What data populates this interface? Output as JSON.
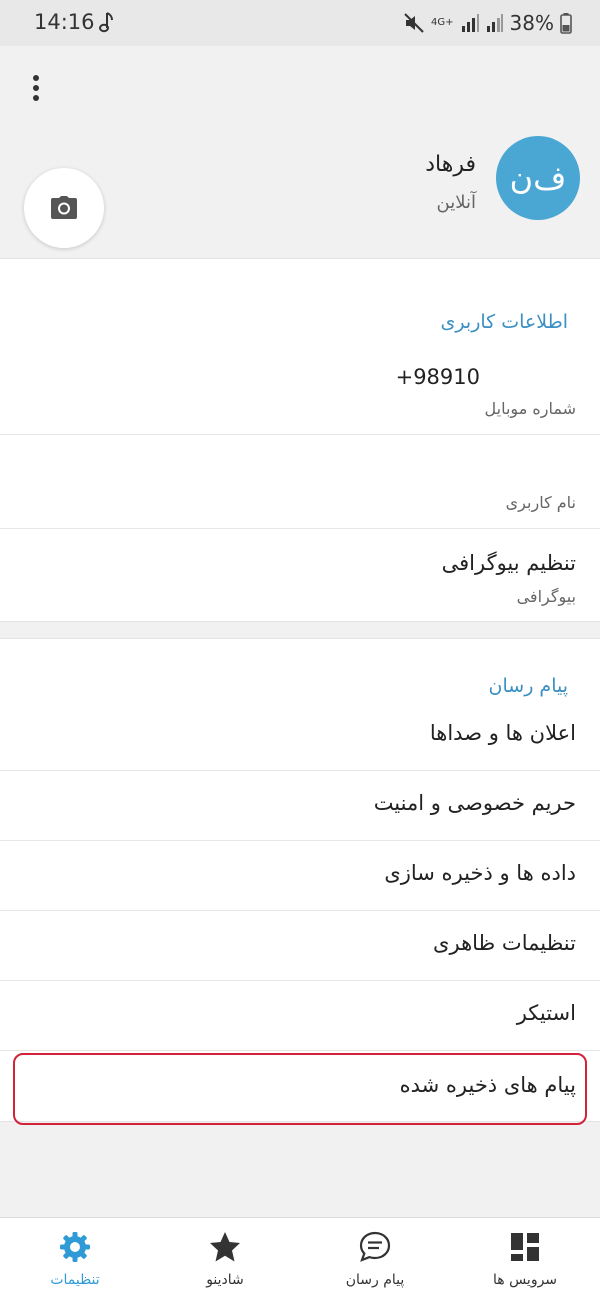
{
  "status_bar": {
    "time": "14:16",
    "network": "4G+",
    "battery": "38%"
  },
  "profile": {
    "avatar_initials": "ف‌ن",
    "name": "فرهاد",
    "status": "آنلاین"
  },
  "user_info": {
    "title": "اطلاعات کاربری",
    "phone_value": "+98910",
    "phone_label": "شماره موبایل",
    "username_value": "",
    "username_label": "نام کاربری",
    "bio_value": "تنظیم بیوگرافی",
    "bio_label": "بیوگرافی"
  },
  "messenger": {
    "title": "پیام رسان",
    "items": [
      {
        "label": "اعلان ها و صداها"
      },
      {
        "label": "حریم خصوصی و امنیت"
      },
      {
        "label": "داده ها و ذخیره سازی"
      },
      {
        "label": "تنظیمات ظاهری"
      },
      {
        "label": "استیکر"
      },
      {
        "label": "پیام های ذخیره شده"
      }
    ]
  },
  "bottom_nav": {
    "items": [
      {
        "label": "سرویس ها",
        "icon": "grid-icon"
      },
      {
        "label": "پیام رسان",
        "icon": "chat-icon"
      },
      {
        "label": "شادینو",
        "icon": "star-icon"
      },
      {
        "label": "تنظیمات",
        "icon": "gear-icon",
        "active": true
      }
    ]
  },
  "colors": {
    "accent": "#2e9bd6",
    "avatar": "#4aa6d3",
    "highlight": "#d2233a"
  }
}
